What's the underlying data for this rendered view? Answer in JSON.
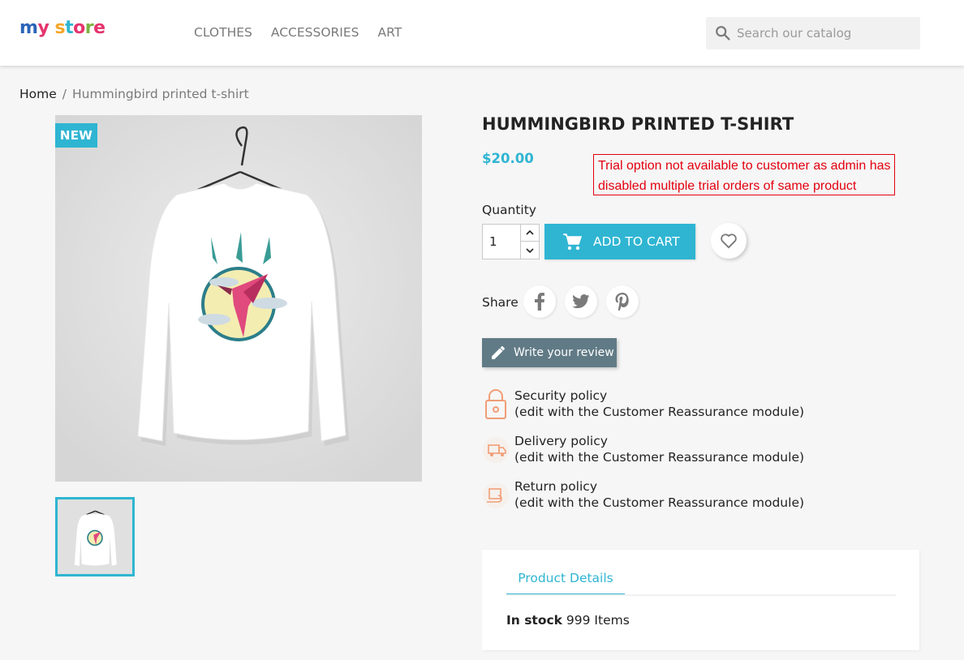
{
  "header": {
    "logo_parts": [
      "m",
      "y",
      " ",
      "s",
      "t",
      "o",
      "r",
      "e"
    ],
    "nav": [
      "CLOTHES",
      "ACCESSORIES",
      "ART"
    ],
    "search_placeholder": "Search our catalog"
  },
  "breadcrumb": {
    "home": "Home",
    "separator": "/",
    "current": "Hummingbird printed t-shirt"
  },
  "product": {
    "badge": "NEW",
    "title": "HUMMINGBIRD PRINTED T-SHIRT",
    "price": "$20.00",
    "trial_notice": "Trial option not available to customer as admin has disabled multiple trial orders of same product",
    "quantity_label": "Quantity",
    "quantity_value": "1",
    "add_to_cart": "ADD TO CART",
    "share_label": "Share",
    "review_button": "Write your review"
  },
  "reassurance": [
    {
      "title": "Security policy",
      "desc": "(edit with the Customer Reassurance module)"
    },
    {
      "title": "Delivery policy",
      "desc": "(edit with the Customer Reassurance module)"
    },
    {
      "title": "Return policy",
      "desc": "(edit with the Customer Reassurance module)"
    }
  ],
  "tabs": {
    "active": "Product Details",
    "stock_label": "In stock",
    "stock_value": "999 Items"
  },
  "colors": {
    "accent": "#2fb5d2",
    "notice_red": "#e3000f",
    "review_button": "#617b86"
  }
}
